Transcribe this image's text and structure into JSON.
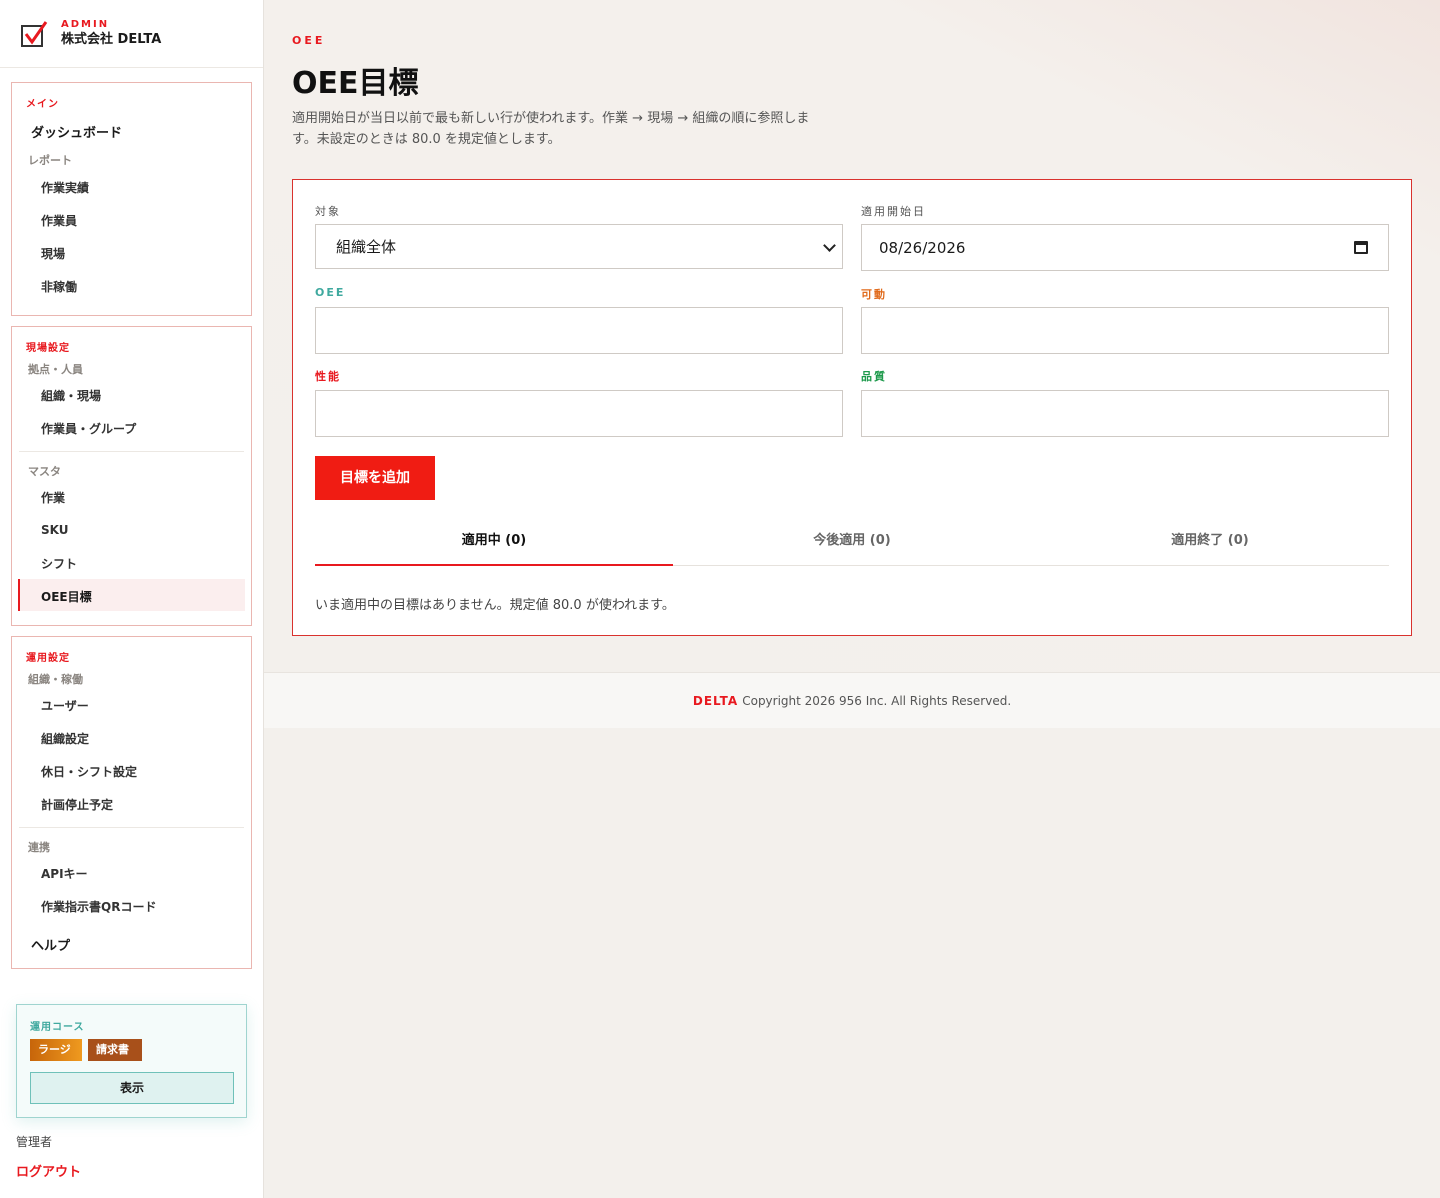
{
  "brand": {
    "kicker": "ADMIN",
    "name": "株式会社 DELTA"
  },
  "sidebar": {
    "main": {
      "title": "メイン",
      "dashboard": "ダッシュボード",
      "reports_label": "レポート",
      "items": [
        "作業実績",
        "作業員",
        "現場",
        "非稼働"
      ]
    },
    "site_settings": {
      "title": "現場設定",
      "sub1": "拠点・人員",
      "sub1_items": [
        "組織・現場",
        "作業員・グループ"
      ],
      "sub2": "マスタ",
      "sub2_items": [
        "作業",
        "SKU",
        "シフト",
        "OEE目標"
      ]
    },
    "ops_settings": {
      "title": "運用設定",
      "sub1": "組織・稼働",
      "sub1_items": [
        "ユーザー",
        "組織設定",
        "休日・シフト設定",
        "計画停止予定"
      ],
      "sub2": "連携",
      "sub2_items": [
        "APIキー",
        "作業指示書QRコード"
      ],
      "help": "ヘルプ"
    },
    "plan": {
      "title": "運用コース",
      "badges": [
        "ラージ",
        "請求書"
      ],
      "button": "表示"
    },
    "user_role": "管理者",
    "logout": "ログアウト"
  },
  "page": {
    "kicker": "OEE",
    "title": "OEE目標",
    "description": "適用開始日が当日以前で最も新しい行が使われます。作業 → 現場 → 組織の順に参照します。未設定のときは 80.0 を規定値とします。"
  },
  "form": {
    "target_label": "対象",
    "target_value": "組織全体",
    "date_label": "適用開始日",
    "date_value": "08/26/2026",
    "oee_label": "OEE",
    "availability_label": "可動",
    "performance_label": "性能",
    "quality_label": "品質",
    "oee_value": "",
    "availability_value": "",
    "performance_value": "",
    "quality_value": "",
    "submit": "目標を追加"
  },
  "tabs": [
    "適用中 (0)",
    "今後適用 (0)",
    "適用終了 (0)"
  ],
  "empty_message": "いま適用中の目標はありません。規定値 80.0 が使われます。",
  "footer": {
    "brand": "DELTA",
    "copyright": "Copyright 2026 956 Inc. All Rights Reserved."
  },
  "colors": {
    "accent": "#e8191f",
    "oee": "#3fa99f",
    "availability": "#e06a1b",
    "quality": "#1e9a4c"
  },
  "icons": {
    "brand": "check-box-logo-icon",
    "select": "chevron-down-icon",
    "date": "calendar-icon"
  }
}
